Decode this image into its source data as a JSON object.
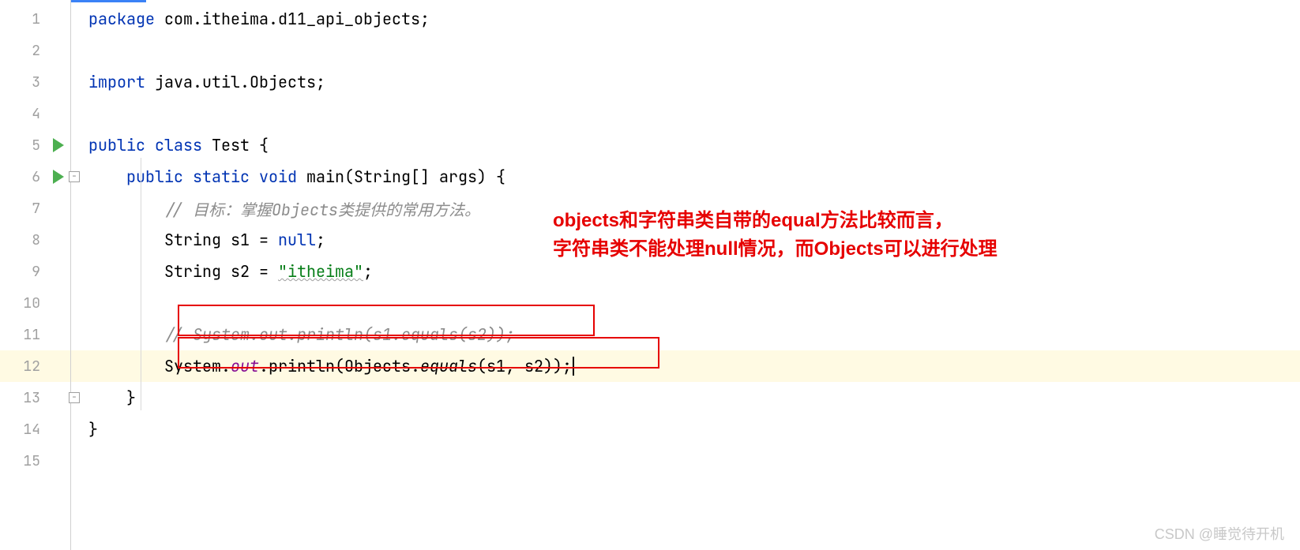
{
  "gutter": {
    "lines": [
      "1",
      "2",
      "3",
      "4",
      "5",
      "6",
      "7",
      "8",
      "9",
      "10",
      "11",
      "12",
      "13",
      "14",
      "15"
    ],
    "runnable_lines": [
      5,
      6
    ]
  },
  "code": {
    "line1": {
      "kw1": "package ",
      "pkg": "com.itheima.d11_api_objects",
      "semi": ";"
    },
    "line3": {
      "kw1": "import ",
      "pkg": "java.util.Objects",
      "semi": ";"
    },
    "line5": {
      "kw1": "public class ",
      "name": "Test",
      "brace": " {"
    },
    "line6": {
      "indent": "    ",
      "kw1": "public static void ",
      "name": "main",
      "params": "(String[] args) {"
    },
    "line7": {
      "indent": "        ",
      "comment": "// 目标：掌握Objects类提供的常用方法。"
    },
    "line8": {
      "indent": "        ",
      "type": "String ",
      "var": "s1 = ",
      "kw": "null",
      "semi": ";"
    },
    "line9": {
      "indent": "        ",
      "type": "String ",
      "var": "s2 = ",
      "str": "\"itheima\"",
      "semi": ";"
    },
    "line11": {
      "indent": "        ",
      "comment": "// System.out.println(s1.equals(s2));"
    },
    "line12": {
      "indent": "        ",
      "cls": "System.",
      "out": "out",
      "dot": ".println(Objects.",
      "eq": "equals",
      "args": "(s1, s2));"
    },
    "line13": {
      "indent": "    ",
      "brace": "}"
    },
    "line14": {
      "brace": "}"
    }
  },
  "annotation": {
    "line1": "objects和字符串类自带的equal方法比较而言，",
    "line2": "字符串类不能处理null情况，而Objects可以进行处理"
  },
  "watermark": "CSDN @睡觉待开机",
  "colors": {
    "keyword": "#0033b3",
    "string": "#067d17",
    "comment": "#8c8c8c",
    "static": "#871094",
    "highlight_bg": "#fffae3",
    "annotation": "#e60000"
  }
}
